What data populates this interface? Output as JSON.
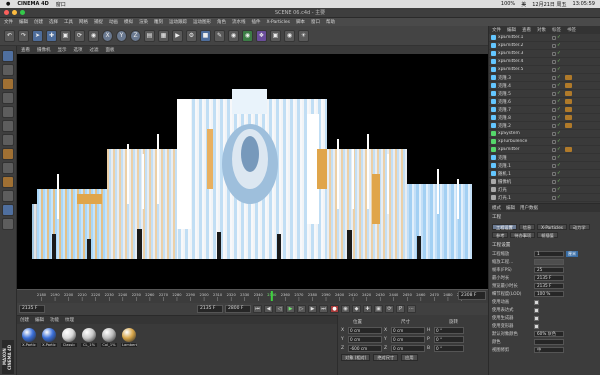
{
  "macbar": {
    "apple": "",
    "app_name": "CINEMA 4D",
    "window_menu": "窗口",
    "status_right": [
      "100%",
      "美",
      "12月21日 周五",
      "13:05:59"
    ]
  },
  "window": {
    "title": "SCENE 06.c4d - 主要"
  },
  "menu": [
    "文件",
    "编辑",
    "创建",
    "选择",
    "工具",
    "网格",
    "捕捉",
    "动画",
    "模拟",
    "渲染",
    "雕刻",
    "运动跟踪",
    "运动图形",
    "角色",
    "流水线",
    "插件",
    "X-Particles",
    "脚本",
    "窗口",
    "帮助"
  ],
  "toolbar": {
    "buttons": [
      "undo",
      "redo",
      "select",
      "move",
      "scale",
      "rotate",
      "recent",
      "X",
      "Y",
      "Z",
      "coord",
      "render-region",
      "render",
      "render-settings",
      "cube",
      "pen",
      "subdivision",
      "cloner",
      "deformer",
      "scene",
      "camera",
      "light"
    ]
  },
  "view_menu": [
    "查看",
    "摄像机",
    "显示",
    "选项",
    "过滤",
    "面板"
  ],
  "timeline": {
    "ticks": [
      "2180",
      "2190",
      "2200",
      "2210",
      "2220",
      "2230",
      "2240",
      "2250",
      "2260",
      "2270",
      "2280",
      "2290",
      "2300",
      "2310",
      "2320",
      "2330",
      "2340",
      "2350",
      "2360",
      "2370",
      "2380",
      "2390",
      "2400",
      "2410",
      "2420",
      "2430",
      "2440",
      "2450",
      "2460",
      "2470",
      "2480",
      "2490"
    ],
    "current_frame": "2350",
    "frame_field": "2308 F"
  },
  "transport": {
    "start": "2135 F",
    "start_field": "2135 F",
    "end_field": "2800 F",
    "end": "2800 F"
  },
  "materials": {
    "menu": [
      "创建",
      "编辑",
      "功能",
      "纹理"
    ],
    "swatches": [
      {
        "label": "X-Partic",
        "color": "#3b6fd8"
      },
      {
        "label": "X-Partic",
        "color": "#3b6fd8"
      },
      {
        "label": "Classic",
        "color": "#d9d9d9"
      },
      {
        "label": "CL_1%",
        "color": "#c9c9c9"
      },
      {
        "label": "Col_1%",
        "color": "#bdbdbd"
      },
      {
        "label": "Lambert",
        "color": "#d7a64a"
      }
    ],
    "brand": "MAXON CINEMA 4D"
  },
  "coords": {
    "headers": [
      "位置",
      "尺寸",
      "旋转"
    ],
    "rows": [
      {
        "axis": "X",
        "pos": "0 cm",
        "size": "0 cm",
        "rot_axis": "H",
        "rot": "0 °"
      },
      {
        "axis": "Y",
        "pos": "0 cm",
        "size": "0 cm",
        "rot_axis": "P",
        "rot": "0 °"
      },
      {
        "axis": "Z",
        "pos": "-600 cm",
        "size": "0 cm",
        "rot_axis": "B",
        "rot": "0 °"
      }
    ],
    "mode": "对象 (相对)",
    "size_mode": "绝对尺寸",
    "apply": "应用"
  },
  "objects": {
    "menu": [
      "文件",
      "编辑",
      "查看",
      "对象",
      "标签",
      "书签"
    ],
    "items": [
      {
        "name": "xpEmitter.1",
        "icon": "#63c6ff",
        "tag": false
      },
      {
        "name": "xpEmitter.2",
        "icon": "#63c6ff",
        "tag": false
      },
      {
        "name": "xpEmitter.3",
        "icon": "#63c6ff",
        "tag": false
      },
      {
        "name": "xpEmitter.4",
        "icon": "#63c6ff",
        "tag": false
      },
      {
        "name": "xpEmitter.5",
        "icon": "#63c6ff",
        "tag": false
      },
      {
        "name": "克隆.3",
        "icon": "#63c6ff",
        "tag": true
      },
      {
        "name": "克隆.4",
        "icon": "#63c6ff",
        "tag": true
      },
      {
        "name": "克隆.5",
        "icon": "#63c6ff",
        "tag": true
      },
      {
        "name": "克隆.6",
        "icon": "#63c6ff",
        "tag": true
      },
      {
        "name": "克隆.7",
        "icon": "#63c6ff",
        "tag": true
      },
      {
        "name": "克隆.8",
        "icon": "#63c6ff",
        "tag": true
      },
      {
        "name": "克隆.2",
        "icon": "#63c6ff",
        "tag": true
      },
      {
        "name": "xpSystem",
        "icon": "#55d66a",
        "tag": false
      },
      {
        "name": "xpTurbulence",
        "icon": "#55d66a",
        "tag": false
      },
      {
        "name": "xpEmitter",
        "icon": "#55d66a",
        "tag": true
      },
      {
        "name": "克隆",
        "icon": "#63c6ff",
        "tag": false
      },
      {
        "name": "克隆.1",
        "icon": "#63c6ff",
        "tag": false
      },
      {
        "name": "随机.1",
        "icon": "#63c6ff",
        "tag": false
      },
      {
        "name": "摄像机",
        "icon": "#aaaaaa",
        "tag": false
      },
      {
        "name": "灯光",
        "icon": "#aaaaaa",
        "tag": false
      },
      {
        "name": "灯光.1",
        "icon": "#aaaaaa",
        "tag": false
      }
    ]
  },
  "attributes": {
    "menu": [
      "模式",
      "编辑",
      "用户数据"
    ],
    "title": "工程",
    "tabs": [
      "工程设置",
      "信息",
      "X-Particles",
      "动力学",
      "参考",
      "待办事项",
      "帧插值"
    ],
    "active_tab": "工程设置",
    "section": "工程设置",
    "rows": [
      {
        "label": "工程缩放",
        "value": "1",
        "type": "field",
        "extra": "厘米"
      },
      {
        "label": "缩放工程...",
        "value": "",
        "type": "button"
      },
      {
        "label": "帧率(FPS)",
        "value": "25",
        "type": "field"
      },
      {
        "label": "最小时长",
        "value": "2135 F",
        "type": "field"
      },
      {
        "label": "预览最小时长",
        "value": "2135 F",
        "type": "field"
      },
      {
        "label": "细节程度(LOD)",
        "value": "100 %",
        "type": "field"
      },
      {
        "label": "使用动画",
        "value": "",
        "type": "check",
        "on": true
      },
      {
        "label": "使用表达式",
        "value": "",
        "type": "check",
        "on": true
      },
      {
        "label": "使用生成器",
        "value": "",
        "type": "check",
        "on": true
      },
      {
        "label": "使用变形器",
        "value": "",
        "type": "check",
        "on": true
      },
      {
        "label": "默认对象颜色",
        "value": "60% 灰色",
        "type": "field"
      },
      {
        "label": "颜色",
        "value": "",
        "type": "field"
      },
      {
        "label": "视图修剪",
        "value": "中",
        "type": "field"
      }
    ]
  }
}
